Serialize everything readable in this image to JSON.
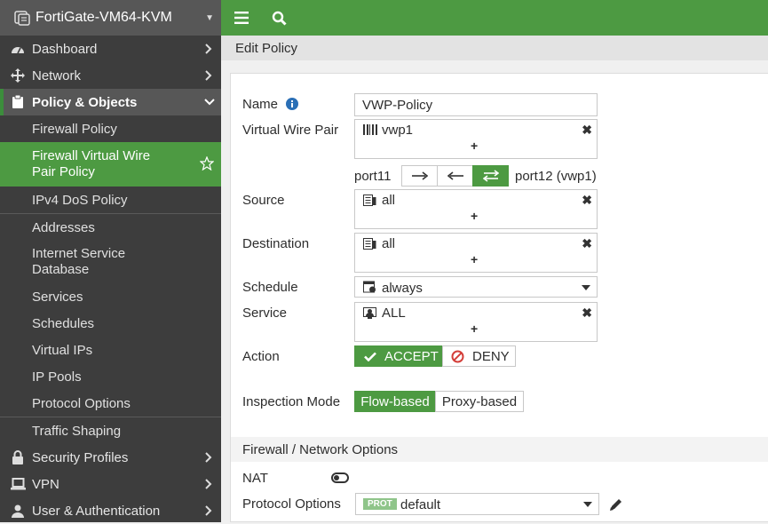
{
  "brand": {
    "device": "FortiGate-VM64-KVM"
  },
  "sidebar": {
    "top_items": [
      {
        "label": "Dashboard"
      },
      {
        "label": "Network"
      }
    ],
    "section": {
      "label": "Policy & Objects"
    },
    "sub_items": [
      {
        "label": "Firewall Policy"
      },
      {
        "label": "Firewall Virtual Wire Pair Policy"
      },
      {
        "label": "IPv4 DoS Policy"
      },
      {
        "label": "Addresses"
      },
      {
        "label": "Internet Service Database"
      },
      {
        "label": "Services"
      },
      {
        "label": "Schedules"
      },
      {
        "label": "Virtual IPs"
      },
      {
        "label": "IP Pools"
      },
      {
        "label": "Protocol Options"
      },
      {
        "label": "Traffic Shaping"
      }
    ],
    "bottom_items": [
      {
        "label": "Security Profiles"
      },
      {
        "label": "VPN"
      },
      {
        "label": "User & Authentication"
      }
    ]
  },
  "page": {
    "title": "Edit Policy"
  },
  "form": {
    "name": {
      "label": "Name",
      "value": "VWP-Policy"
    },
    "vwp": {
      "label": "Virtual Wire Pair",
      "value": "vwp1"
    },
    "ports": {
      "left": "port11",
      "right": "port12 (vwp1)"
    },
    "source": {
      "label": "Source",
      "value": "all"
    },
    "destination": {
      "label": "Destination",
      "value": "all"
    },
    "schedule": {
      "label": "Schedule",
      "value": "always"
    },
    "service": {
      "label": "Service",
      "value": "ALL"
    },
    "action": {
      "label": "Action",
      "accept": "ACCEPT",
      "deny": "DENY"
    },
    "inspection": {
      "label": "Inspection Mode",
      "flow": "Flow-based",
      "proxy": "Proxy-based"
    },
    "section_title": "Firewall / Network Options",
    "nat": {
      "label": "NAT"
    },
    "protocol": {
      "label": "Protocol Options",
      "badge": "PROT",
      "value": "default"
    },
    "plus": "+",
    "remove": "✖"
  },
  "colors": {
    "accent": "#4d9a42",
    "sidebar": "#3d3d3d",
    "deny": "#d43f3a"
  }
}
